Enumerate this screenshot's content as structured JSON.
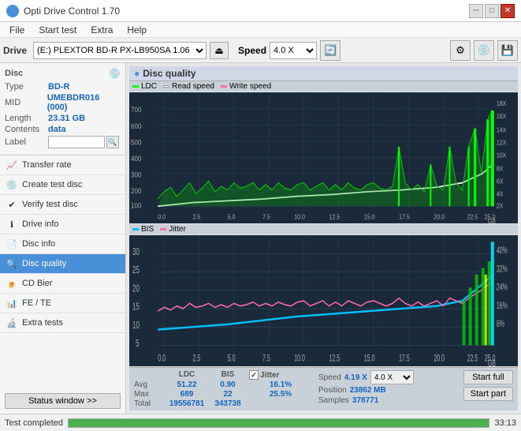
{
  "titlebar": {
    "title": "Opti Drive Control 1.70",
    "icon": "●",
    "minimize": "─",
    "maximize": "□",
    "close": "✕"
  },
  "menubar": {
    "items": [
      "File",
      "Start test",
      "Extra",
      "Help"
    ]
  },
  "toolbar": {
    "drive_label": "Drive",
    "drive_value": "(E:) PLEXTOR BD-R  PX-LB950SA 1.06",
    "speed_label": "Speed",
    "speed_value": "4.0 X",
    "eject_icon": "⏏"
  },
  "disc": {
    "type_label": "Type",
    "type_value": "BD-R",
    "mid_label": "MID",
    "mid_value": "UMEBDR016 (000)",
    "length_label": "Length",
    "length_value": "23.31 GB",
    "contents_label": "Contents",
    "contents_value": "data",
    "label_label": "Label",
    "label_value": ""
  },
  "nav": {
    "items": [
      {
        "id": "transfer-rate",
        "label": "Transfer rate",
        "icon": "📈"
      },
      {
        "id": "create-test-disc",
        "label": "Create test disc",
        "icon": "💿"
      },
      {
        "id": "verify-test-disc",
        "label": "Verify test disc",
        "icon": "✔"
      },
      {
        "id": "drive-info",
        "label": "Drive info",
        "icon": "ℹ"
      },
      {
        "id": "disc-info",
        "label": "Disc info",
        "icon": "📄"
      },
      {
        "id": "disc-quality",
        "label": "Disc quality",
        "icon": "🔍",
        "active": true
      },
      {
        "id": "cd-bier",
        "label": "CD Bier",
        "icon": "🍺"
      },
      {
        "id": "fe-te",
        "label": "FE / TE",
        "icon": "📊"
      },
      {
        "id": "extra-tests",
        "label": "Extra tests",
        "icon": "🔬"
      }
    ],
    "status_window": "Status window >>"
  },
  "chart": {
    "title": "Disc quality",
    "legend1": {
      "ldc_label": "LDC",
      "read_label": "Read speed",
      "write_label": "Write speed"
    },
    "legend2": {
      "bis_label": "BIS",
      "jitter_label": "Jitter"
    },
    "y_axis1": [
      "700",
      "600",
      "500",
      "400",
      "300",
      "200",
      "100"
    ],
    "y_axis1_right": [
      "18X",
      "16X",
      "14X",
      "12X",
      "10X",
      "8X",
      "6X",
      "4X",
      "2X"
    ],
    "y_axis2": [
      "30",
      "25",
      "20",
      "15",
      "10",
      "5"
    ],
    "y_axis2_right": [
      "40%",
      "32%",
      "24%",
      "16%",
      "8%"
    ],
    "x_axis": [
      "0.0",
      "2.5",
      "5.0",
      "7.5",
      "10.0",
      "12.5",
      "15.0",
      "17.5",
      "20.0",
      "22.5",
      "25.0"
    ],
    "x_label": "GB"
  },
  "stats": {
    "ldc_label": "LDC",
    "bis_label": "BIS",
    "jitter_label": "Jitter",
    "speed_label": "Speed",
    "speed_value": "4.19 X",
    "speed_select": "4.0 X",
    "jitter_checked": true,
    "avg_label": "Avg",
    "avg_ldc": "51.22",
    "avg_bis": "0.90",
    "avg_jitter": "16.1%",
    "max_label": "Max",
    "max_ldc": "689",
    "max_bis": "22",
    "max_jitter": "25.5%",
    "total_label": "Total",
    "total_ldc": "19556781",
    "total_bis": "343738",
    "position_label": "Position",
    "position_value": "23862 MB",
    "samples_label": "Samples",
    "samples_value": "378771",
    "start_full": "Start full",
    "start_part": "Start part"
  },
  "statusbar": {
    "text": "Test completed",
    "progress": 100,
    "time": "33:13"
  },
  "colors": {
    "ldc": "#00ff00",
    "read_speed": "#ffffff",
    "write_speed": "#ff69b4",
    "bis": "#00bfff",
    "jitter": "#ff69b4",
    "chart_bg": "#1a2a3a",
    "grid": "#2a3d50",
    "accent": "#4a90d9",
    "active_nav": "#4a90d9"
  }
}
